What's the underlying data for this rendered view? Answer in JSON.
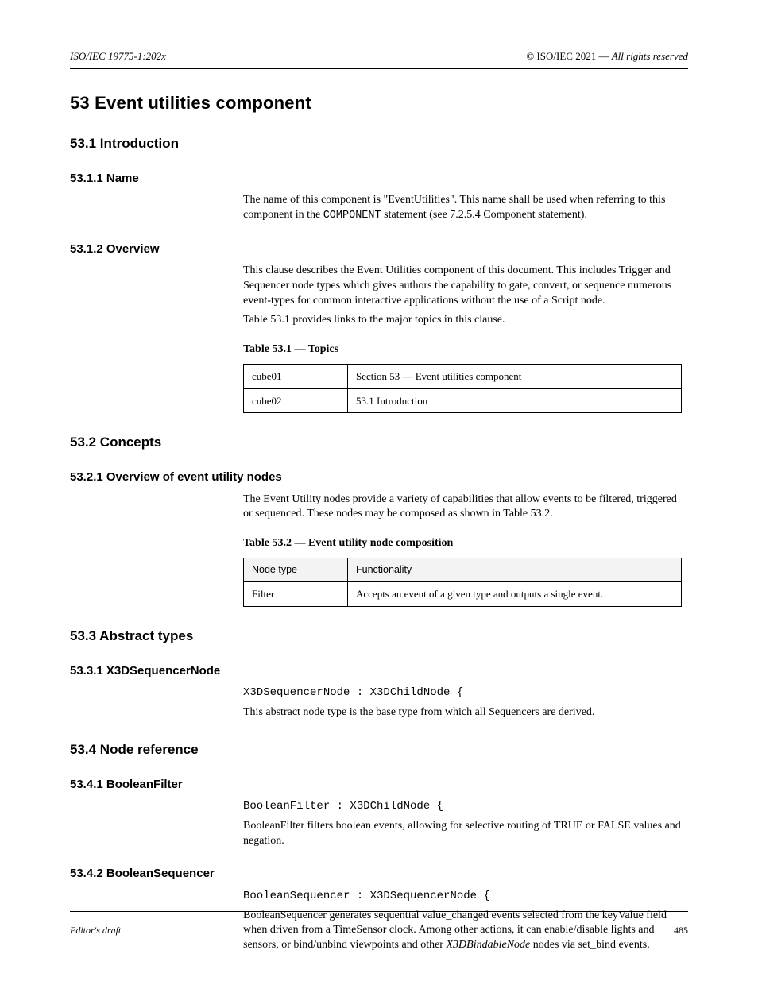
{
  "runningHead": {
    "left": "ISO/IEC 19775-1:202x",
    "rightPrefix": "© ISO/IEC 2021 —",
    "rightItalic": "All rights reserved"
  },
  "title": "53 Event utilities component",
  "s1": {
    "h": "53.1 Introduction",
    "sub": "53.1.1 Name",
    "p1a": "The name of this component is \"EventUtilities\". This name shall be used when referring to this component in the ",
    "p1b": "COMPONENT",
    "p1c": " statement (see 7.2.5.4 Component statement).",
    "sub2": "53.1.2 Overview",
    "p2": "This clause describes the Event Utilities component of this document. This includes Trigger and Sequencer node types which gives authors the capability to gate, convert, or sequence numerous event-types for common interactive applications without the use of a Script node.",
    "p3": "Table 53.1 provides links to the major topics in this clause.",
    "cap1": "Table 53.1 — Topics",
    "t1": {
      "r1c1": "cube01",
      "r1c2": "Section 53 — Event utilities component",
      "r2c1": "cube02",
      "r2c2": "53.1 Introduction"
    }
  },
  "s2": {
    "h": "53.2 Concepts",
    "sub": "53.2.1 Overview of event utility nodes",
    "p1": "The Event Utility nodes provide a variety of capabilities that allow events to be filtered, triggered or sequenced. These nodes may be composed as shown in Table 53.2.",
    "cap2": "Table 53.2 — Event utility node composition",
    "t2": {
      "hc1": "Node type",
      "hc2": "Functionality",
      "r1c1": "Filter",
      "r1c2": "Accepts an event of a given type and outputs a single event."
    }
  },
  "s3": {
    "h": "53.3 Abstract types",
    "sub": "53.3.1 X3DSequencerNode",
    "code": "X3DSequencerNode : X3DChildNode {",
    "p1": "This abstract node type is the base type from which all Sequencers are derived."
  },
  "s4": {
    "h": "53.4 Node reference",
    "sub": "53.4.1 BooleanFilter",
    "code": "BooleanFilter : X3DChildNode {",
    "p1": "BooleanFilter filters boolean events, allowing for selective routing of TRUE or FALSE values and negation.",
    "sub2": "53.4.2 BooleanSequencer",
    "code2": "BooleanSequencer : X3DSequencerNode {",
    "p2a": "BooleanSequencer generates sequential value_changed events selected from the keyValue field when driven from a TimeSensor clock. Among other actions, it can enable/disable lights and sensors, or bind/unbind viewpoints and other ",
    "p2b": "X3DBindableNode",
    "p2c": " nodes via set_bind events."
  },
  "footer": {
    "leftLabel": "Editor's draft",
    "pageLabel": "485"
  }
}
